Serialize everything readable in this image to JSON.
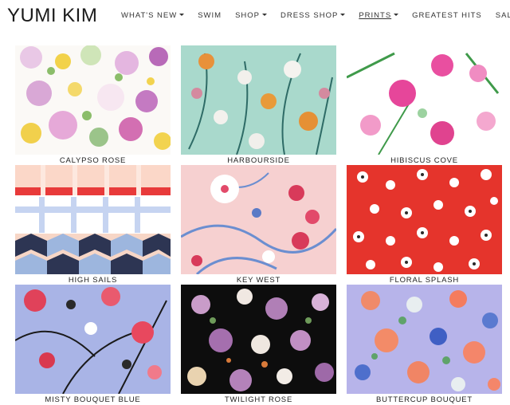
{
  "header": {
    "logo": "YUMI KIM",
    "nav": [
      {
        "label": "WHAT'S NEW",
        "caret": true
      },
      {
        "label": "SWIM",
        "caret": false
      },
      {
        "label": "SHOP",
        "caret": true
      },
      {
        "label": "DRESS SHOP",
        "caret": true
      },
      {
        "label": "PRINTS",
        "caret": true
      },
      {
        "label": "GREATEST HITS",
        "caret": false
      },
      {
        "label": "SALE",
        "caret": false
      }
    ]
  },
  "prints": [
    {
      "name": "CALYPSO ROSE"
    },
    {
      "name": "HARBOURSIDE"
    },
    {
      "name": "HIBISCUS COVE"
    },
    {
      "name": "HIGH SAILS"
    },
    {
      "name": "KEY WEST"
    },
    {
      "name": "FLORAL SPLASH"
    },
    {
      "name": "MISTY BOUQUET BLUE"
    },
    {
      "name": "TWILIGHT ROSE"
    },
    {
      "name": "BUTTERCUP BOUQUET"
    }
  ]
}
